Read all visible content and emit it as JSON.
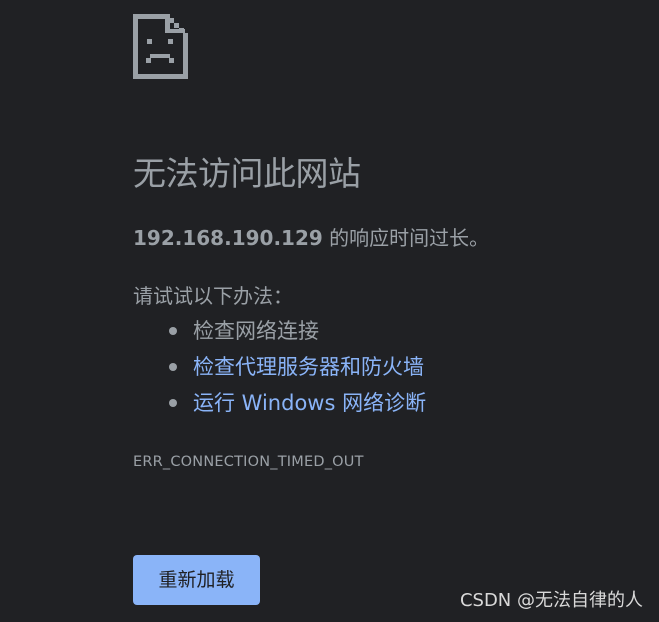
{
  "page": {
    "icon": "sad-page-icon",
    "title": "无法访问此网站",
    "summary": {
      "host": "192.168.190.129",
      "message": " 的响应时间过长。"
    },
    "suggestions_heading": "请试试以下办法：",
    "suggestions": [
      {
        "label": "检查网络连接",
        "is_link": false
      },
      {
        "label": "检查代理服务器和防火墙",
        "is_link": true
      },
      {
        "label": "运行 Windows 网络诊断",
        "is_link": true
      }
    ],
    "error_code": "ERR_CONNECTION_TIMED_OUT",
    "reload_label": "重新加载"
  },
  "watermark": "CSDN @无法自律的人",
  "colors": {
    "background": "#202124",
    "text": "#9aa0a6",
    "link": "#8ab4f8",
    "button": "#8ab4f8"
  }
}
